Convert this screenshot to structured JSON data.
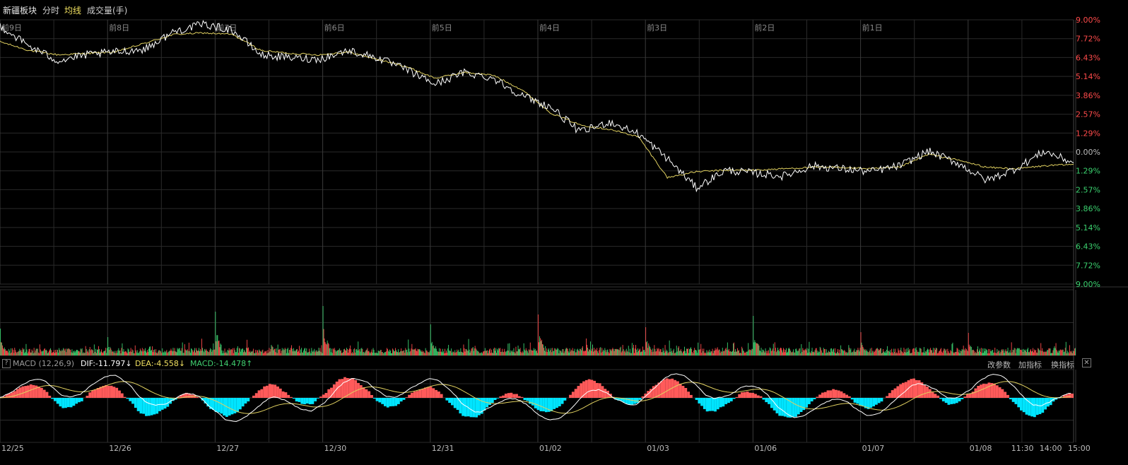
{
  "header": {
    "title": "新疆板块",
    "fenshi_label": "分时",
    "avg_label": "均线",
    "volume_label": "成交量(手)"
  },
  "macd": {
    "help_label": "?",
    "name": "MACD (12,26,9)",
    "dif": "DIF:-11.797↓",
    "dea": "DEA:-4.558↓",
    "macd": "MACD:-14.478↑",
    "btn_params": "改参数",
    "btn_add": "加指标",
    "btn_swap": "换指标",
    "close_label": "✕"
  },
  "colors": {
    "background": "#000000",
    "grid": "#2a2a2a",
    "price_line": "#ffffff",
    "avg_line": "#e0d060",
    "up": "#ff4b4b",
    "down": "#3bd16f",
    "macd_neg": "#00e5ff",
    "macd_pos": "#ff5a5a"
  },
  "chart_data": {
    "type": "line",
    "title": "新疆板块",
    "y_ticks_up": [
      "9.00%",
      "7.72%",
      "6.43%",
      "5.14%",
      "3.86%",
      "2.57%",
      "1.29%"
    ],
    "y_tick_zero": "0.00%",
    "y_ticks_down": [
      "1.29%",
      "2.57%",
      "3.86%",
      "5.14%",
      "6.43%",
      "7.72%",
      "9.00%"
    ],
    "ylim": [
      -9.0,
      9.0
    ],
    "day_labels": [
      "前9日",
      "前8日",
      "前7日",
      "前6日",
      "前5日",
      "前4日",
      "前3日",
      "前2日",
      "前1日"
    ],
    "dates": [
      "12/25",
      "12/26",
      "12/27",
      "12/30",
      "12/31",
      "01/02",
      "01/03",
      "01/06",
      "01/07",
      "01/08"
    ],
    "time_labels": [
      "11:30",
      "14:00",
      "15:00"
    ],
    "series": [
      {
        "name": "分时",
        "values": [
          8.6,
          7.2,
          6.2,
          6.6,
          6.8,
          7.0,
          8.2,
          8.7,
          8.3,
          6.6,
          6.4,
          6.3,
          6.9,
          6.4,
          5.6,
          4.6,
          5.4,
          5.0,
          3.8,
          3.0,
          1.3,
          2.0,
          1.2,
          -0.5,
          -2.5,
          -1.3,
          -1.5,
          -1.7,
          -1.0,
          -1.2,
          -1.4,
          -1.0,
          0.0,
          -0.8,
          -2.0,
          -1.2,
          0.0,
          -0.8
        ]
      },
      {
        "name": "均线",
        "values": [
          7.5,
          6.9,
          6.6,
          6.7,
          6.8,
          7.4,
          8.0,
          8.1,
          8.0,
          6.9,
          6.7,
          6.6,
          6.8,
          6.3,
          5.8,
          5.0,
          5.4,
          5.2,
          4.2,
          2.6,
          1.8,
          1.5,
          1.0,
          -1.8,
          -1.4,
          -1.3,
          -1.3,
          -1.2,
          -1.1,
          -1.1,
          -1.2,
          -1.1,
          -0.2,
          -0.6,
          -1.1,
          -1.2,
          -1.0,
          -0.9
        ]
      }
    ],
    "volume": {
      "label": "成交量(手)",
      "spikes_per_day_open": [
        38,
        26,
        62,
        70,
        44,
        58,
        40,
        56,
        33,
        32
      ]
    },
    "macd_indicator": {
      "params": "12,26,9",
      "dif": -11.797,
      "dea": -4.558,
      "macd": -14.478
    }
  }
}
